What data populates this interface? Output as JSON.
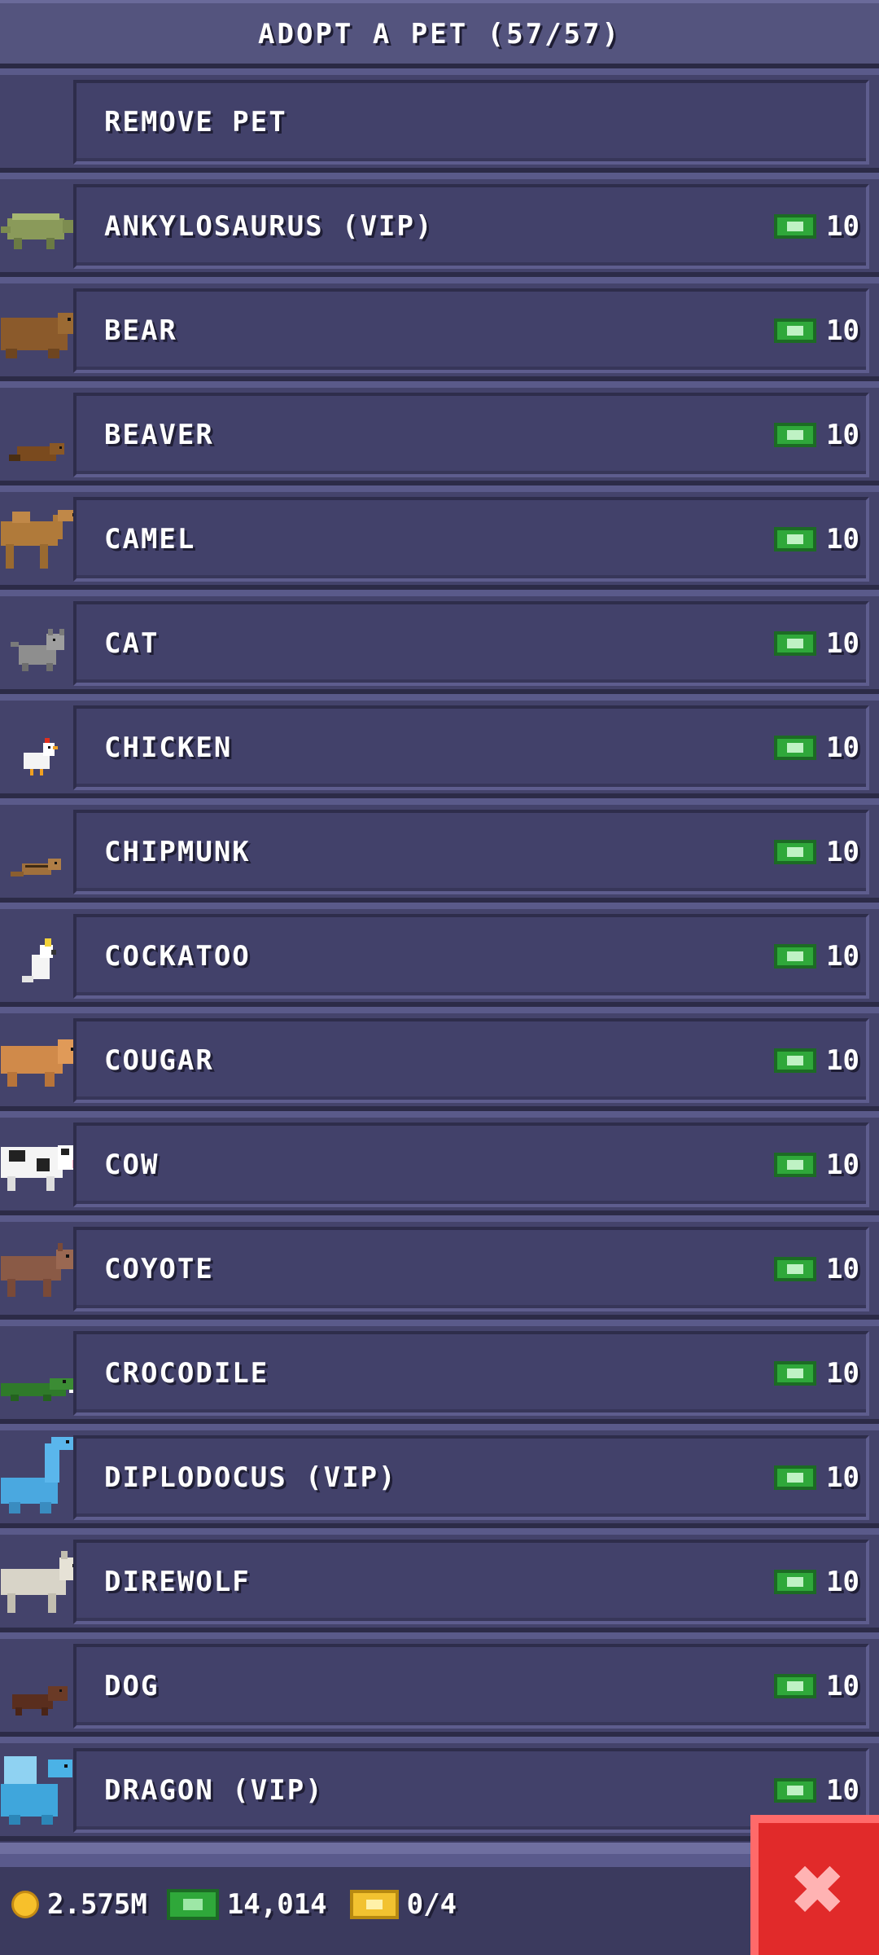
{
  "header": {
    "title": "ADOPT A PET (57/57)"
  },
  "list": {
    "remove": {
      "label": "REMOVE PET"
    },
    "items": [
      {
        "label": "ANKYLOSAURUS (VIP)",
        "price": "10",
        "icon": "ankylosaurus-icon"
      },
      {
        "label": "BEAR",
        "price": "10",
        "icon": "bear-icon"
      },
      {
        "label": "BEAVER",
        "price": "10",
        "icon": "beaver-icon"
      },
      {
        "label": "CAMEL",
        "price": "10",
        "icon": "camel-icon"
      },
      {
        "label": "CAT",
        "price": "10",
        "icon": "cat-icon"
      },
      {
        "label": "CHICKEN",
        "price": "10",
        "icon": "chicken-icon"
      },
      {
        "label": "CHIPMUNK",
        "price": "10",
        "icon": "chipmunk-icon"
      },
      {
        "label": "COCKATOO",
        "price": "10",
        "icon": "cockatoo-icon"
      },
      {
        "label": "COUGAR",
        "price": "10",
        "icon": "cougar-icon"
      },
      {
        "label": "COW",
        "price": "10",
        "icon": "cow-icon"
      },
      {
        "label": "COYOTE",
        "price": "10",
        "icon": "coyote-icon"
      },
      {
        "label": "CROCODILE",
        "price": "10",
        "icon": "crocodile-icon"
      },
      {
        "label": "DIPLODOCUS (VIP)",
        "price": "10",
        "icon": "diplodocus-icon"
      },
      {
        "label": "DIREWOLF",
        "price": "10",
        "icon": "direwolf-icon"
      },
      {
        "label": "DOG",
        "price": "10",
        "icon": "dog-icon"
      },
      {
        "label": "DRAGON (VIP)",
        "price": "10",
        "icon": "dragon-icon"
      }
    ]
  },
  "footer": {
    "coins": "2.575M",
    "cash": "14,014",
    "tickets": "0/4"
  },
  "colors": {
    "background": "#3d3c62",
    "cash_green": "#2fa83a",
    "close_red": "#e12a2a",
    "coin_gold": "#f7c02b"
  }
}
